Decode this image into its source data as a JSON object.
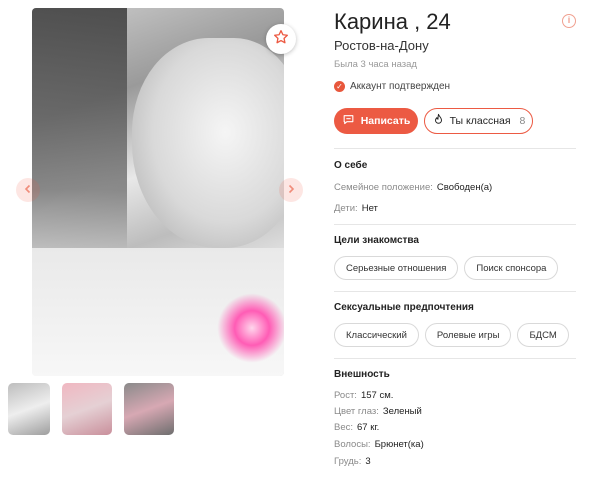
{
  "profile": {
    "name": "Карина , 24",
    "city": "Ростов-на-Дону",
    "last_seen": "Была 3 часа назад",
    "verified": "Аккаунт подтвержден",
    "info_glyph": "i"
  },
  "actions": {
    "write_label": "Написать",
    "like_label": "Ты классная",
    "like_count": "8"
  },
  "about": {
    "title": "О себе",
    "marital_label": "Семейное положение:",
    "marital_value": "Свободен(а)",
    "kids_label": "Дети:",
    "kids_value": "Нет"
  },
  "goals": {
    "title": "Цели знакомства",
    "items": [
      "Серьезные отношения",
      "Поиск спонсора"
    ]
  },
  "preferences": {
    "title": "Сексуальные предпочтения",
    "items": [
      "Классический",
      "Ролевые игры",
      "БДСМ"
    ]
  },
  "appearance": {
    "title": "Внешность",
    "height_label": "Рост:",
    "height_value": "157 см.",
    "eyes_label": "Цвет глаз:",
    "eyes_value": "Зеленый",
    "weight_label": "Вес:",
    "weight_value": "67 кг.",
    "hair_label": "Волосы:",
    "hair_value": "Брюнет(ка)",
    "breast_label": "Грудь:",
    "breast_value": "3"
  },
  "icons": {
    "favorite": "star-icon",
    "prev": "chevron-left-icon",
    "next": "chevron-right-icon",
    "message": "chat-icon",
    "like": "flame-icon",
    "verified": "check-icon"
  },
  "colors": {
    "accent": "#ec5a43",
    "muted": "#8a8a8a"
  }
}
